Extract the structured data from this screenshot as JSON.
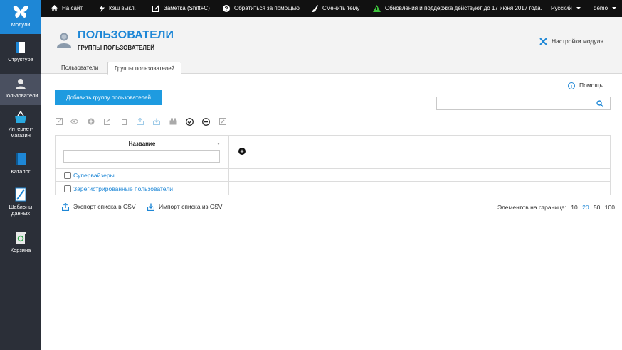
{
  "sidebar": {
    "items": [
      {
        "label": "Модули",
        "icon": "butterfly-logo-icon"
      },
      {
        "label": "Структура",
        "icon": "structure-icon"
      },
      {
        "label": "Пользователи",
        "icon": "user-icon"
      },
      {
        "label_line1": "Интернет-",
        "label_line2": "магазин",
        "icon": "shopping-basket-icon"
      },
      {
        "label": "Каталог",
        "icon": "catalog-book-icon"
      },
      {
        "label_line1": "Шаблоны",
        "label_line2": "данных",
        "icon": "data-templates-icon"
      },
      {
        "label": "Корзина",
        "icon": "recycle-bin-icon"
      }
    ]
  },
  "topbar": {
    "to_site": "На сайт",
    "cache": "Кэш выкл.",
    "note": "Заметка (Shift+C)",
    "help": "Обратиться за помощью",
    "theme": "Сменить тему",
    "updates": "Обновления и поддержка действуют до 17 июня 2017 года.",
    "language": "Русский",
    "user": "demo"
  },
  "header": {
    "title": "ПОЛЬЗОВАТЕЛИ",
    "subtitle": "ГРУППЫ ПОЛЬЗОВАТЕЛЕЙ",
    "settings": "Настройки модуля"
  },
  "tabs": [
    {
      "label": "Пользователи",
      "active": false
    },
    {
      "label": "Группы пользователей",
      "active": true
    }
  ],
  "content": {
    "add_button": "Добавить группу пользователей",
    "help": "Помощь",
    "search_placeholder": ""
  },
  "grid": {
    "column_name": "Название",
    "filter_placeholder": "",
    "add_column": "+",
    "rows": [
      {
        "name": "Супервайзеры"
      },
      {
        "name": "Зарегистрированные пользователи"
      }
    ]
  },
  "footer": {
    "export": "Экспорт списка в CSV",
    "import": "Импорт списка из CSV",
    "per_page_label": "Элементов на странице:",
    "per_page_options": [
      "10",
      "20",
      "50",
      "100"
    ],
    "per_page_selected": "20"
  },
  "colors": {
    "accent": "#1e87d6",
    "button": "#1e9be0",
    "sidebar": "#2b2f38",
    "topbar": "#111111",
    "update_warning": "#3cc13b"
  }
}
